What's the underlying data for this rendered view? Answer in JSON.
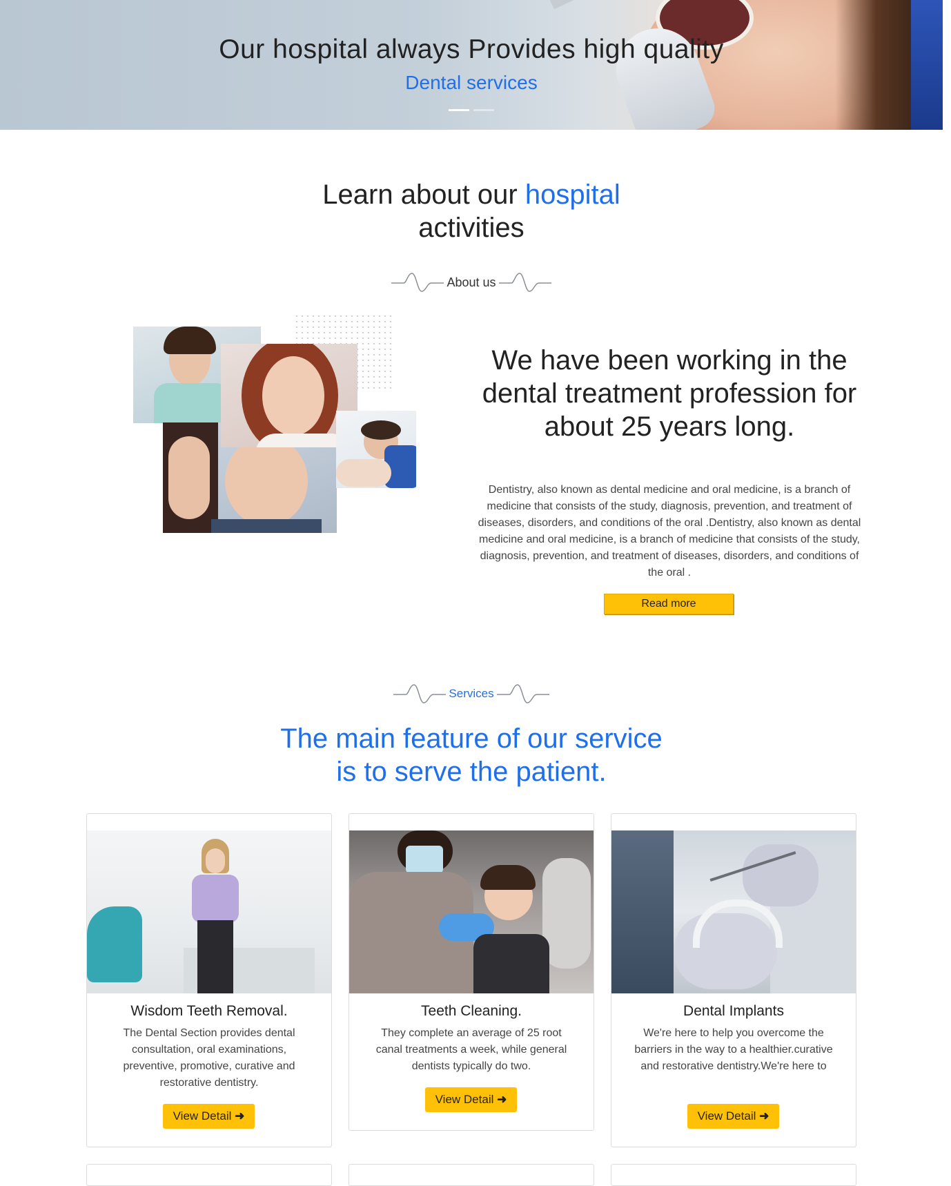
{
  "hero": {
    "title": "Our hospital always Provides high quality",
    "subtitle": "Dental services",
    "slides": [
      {
        "active": true
      },
      {
        "active": false
      }
    ]
  },
  "about": {
    "heading_part1": "Learn about our ",
    "heading_highlight": "hospital",
    "heading_part2": "activities",
    "divider_label": "About us",
    "title": "We have been working in the dental treatment profession for about 25 years long.",
    "text": "Dentistry, also known as dental medicine and oral medicine, is a branch of medicine that consists of the study, diagnosis, prevention, and treatment of diseases, disorders, and conditions of the oral .Dentistry, also known as dental medicine and oral medicine, is a branch of medicine that consists of the study, diagnosis, prevention, and treatment of diseases, disorders, and conditions of the oral .",
    "read_more": "Read more"
  },
  "services": {
    "divider_label": "Services",
    "heading_line1": "The main feature of our service",
    "heading_line2": "is to serve the patient.",
    "cards": [
      {
        "title": "Wisdom Teeth Removal.",
        "text": "The Dental Section provides dental consultation, oral examinations, preventive, promotive, curative and restorative dentistry.",
        "button": "View Detail"
      },
      {
        "title": "Teeth Cleaning.",
        "text": "They complete an average of 25 root canal treatments a week, while general dentists typically do two.",
        "button": "View Detail"
      },
      {
        "title": "Dental Implants",
        "text": "We're here to help you overcome the barriers in the way to a healthier.curative and restorative dentistry.We're here to",
        "button": "View Detail"
      }
    ]
  },
  "colors": {
    "accent_blue": "#1f6feb",
    "button_yellow": "#ffc107"
  }
}
